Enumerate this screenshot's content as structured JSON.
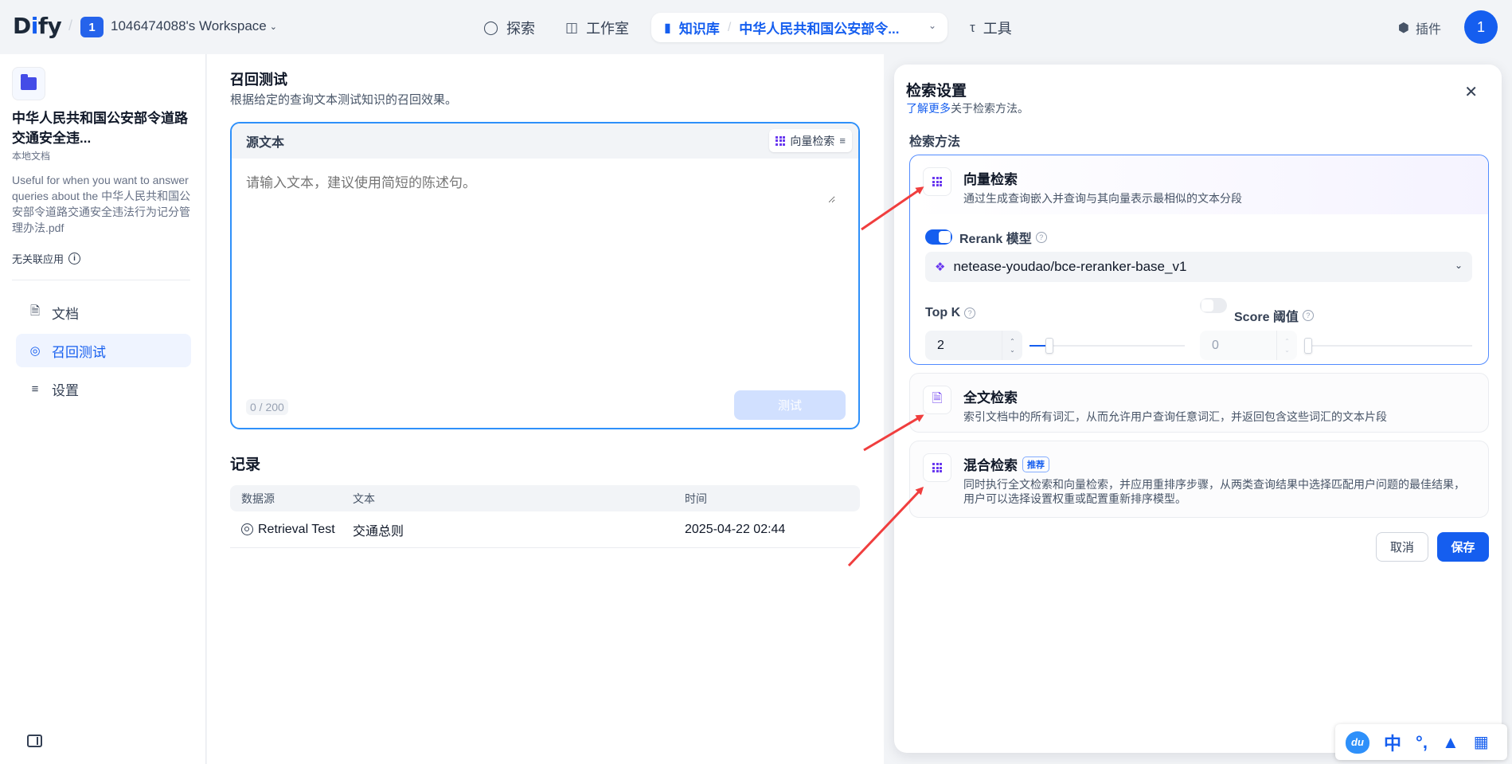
{
  "nav": {
    "logo": "Dify",
    "workspace_badge": "1",
    "workspace_name": "1046474088's Workspace",
    "explore": "探索",
    "studio": "工作室",
    "knowledge": "知识库",
    "kb_name": "中华人民共和国公安部令...",
    "tools": "工具",
    "plugins": "插件",
    "avatar": "1"
  },
  "sidebar": {
    "kb_title": "中华人民共和国公安部令道路交通安全违...",
    "kb_type": "本地文档",
    "description": "Useful for when you want to answer queries about the 中华人民共和国公安部令道路交通安全违法行为记分管理办法.pdf",
    "no_app": "无关联应用",
    "items": [
      {
        "label": "文档",
        "icon": "document-icon"
      },
      {
        "label": "召回测试",
        "icon": "target-icon"
      },
      {
        "label": "设置",
        "icon": "settings-icon"
      }
    ]
  },
  "main": {
    "title": "召回测试",
    "subtitle": "根据给定的查询文本测试知识的召回效果。",
    "source_label": "源文本",
    "method_button": "向量检索",
    "placeholder": "请输入文本，建议使用简短的陈述句。",
    "counter": "0 / 200",
    "test_button": "测试",
    "records_title": "记录",
    "columns": [
      "数据源",
      "文本",
      "时间"
    ],
    "rows": [
      {
        "source": "Retrieval Test",
        "text": "交通总则",
        "time": "2025-04-22 02:44"
      }
    ]
  },
  "panel": {
    "title": "检索设置",
    "learn_more": "了解更多",
    "learn_more_suffix": "关于检索方法。",
    "method_label": "检索方法",
    "vector": {
      "title": "向量检索",
      "desc": "通过生成查询嵌入并查询与其向量表示最相似的文本分段",
      "rerank_label": "Rerank 模型",
      "rerank_enabled": true,
      "rerank_model": "netease-youdao/bce-reranker-base_v1",
      "topk_label": "Top K",
      "topk_value": "2",
      "score_label": "Score 阈值",
      "score_enabled": false,
      "score_value": "0"
    },
    "fulltext": {
      "title": "全文检索",
      "desc": "索引文档中的所有词汇，从而允许用户查询任意词汇，并返回包含这些词汇的文本片段"
    },
    "hybrid": {
      "title": "混合检索",
      "tag": "推荐",
      "desc": "同时执行全文检索和向量检索，并应用重排序步骤，从两类查询结果中选择匹配用户问题的最佳结果，用户可以选择设置权重或配置重新排序模型。"
    },
    "cancel": "取消",
    "save": "保存"
  },
  "ime": {
    "logo": "du",
    "lang": "中",
    "punct": "°,"
  },
  "colors": {
    "accent": "#155eef",
    "annotation_arrow": "#f03e3e"
  }
}
